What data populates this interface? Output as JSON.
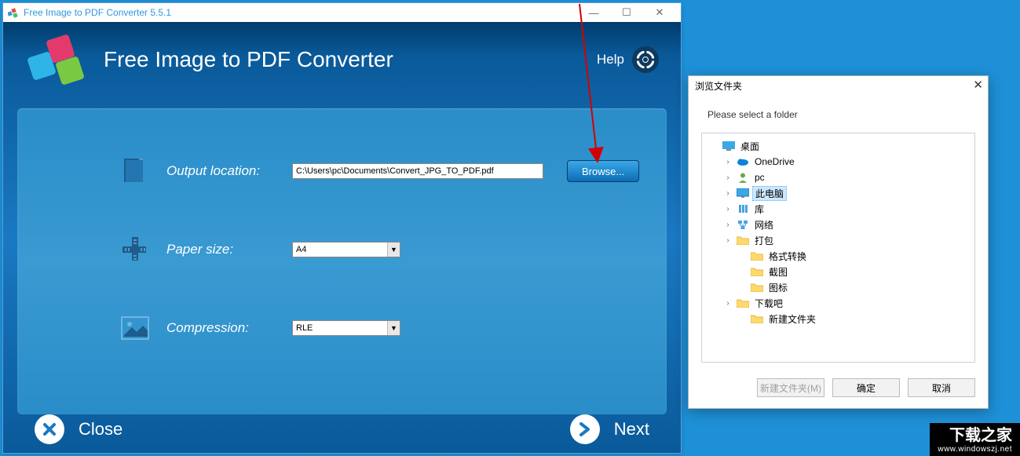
{
  "titlebar": {
    "title": "Free Image to PDF Converter 5.5.1"
  },
  "header": {
    "app_title": "Free Image to PDF Converter",
    "help_label": "Help"
  },
  "form": {
    "output_label": "Output location:",
    "output_value": "C:\\Users\\pc\\Documents\\Convert_JPG_TO_PDF.pdf",
    "browse_label": "Browse...",
    "paper_label": "Paper size:",
    "paper_value": "A4",
    "compression_label": "Compression:",
    "compression_value": "RLE"
  },
  "footer": {
    "close_label": "Close",
    "next_label": "Next"
  },
  "dialog": {
    "title": "浏览文件夹",
    "prompt": "Please select a folder",
    "tree": [
      {
        "indent": 0,
        "exp": "",
        "icon": "desktop",
        "label": "桌面",
        "selected": false
      },
      {
        "indent": 1,
        "exp": "›",
        "icon": "onedrive",
        "label": "OneDrive",
        "selected": false
      },
      {
        "indent": 1,
        "exp": "›",
        "icon": "user",
        "label": "pc",
        "selected": false
      },
      {
        "indent": 1,
        "exp": "›",
        "icon": "pc",
        "label": "此电脑",
        "selected": true
      },
      {
        "indent": 1,
        "exp": "›",
        "icon": "lib",
        "label": "库",
        "selected": false
      },
      {
        "indent": 1,
        "exp": "›",
        "icon": "net",
        "label": "网络",
        "selected": false
      },
      {
        "indent": 1,
        "exp": "›",
        "icon": "folder",
        "label": "打包",
        "selected": false
      },
      {
        "indent": 2,
        "exp": "",
        "icon": "folder",
        "label": "格式转换",
        "selected": false
      },
      {
        "indent": 2,
        "exp": "",
        "icon": "folder",
        "label": "截图",
        "selected": false
      },
      {
        "indent": 2,
        "exp": "",
        "icon": "folder",
        "label": "图标",
        "selected": false
      },
      {
        "indent": 1,
        "exp": "›",
        "icon": "folder",
        "label": "下载吧",
        "selected": false
      },
      {
        "indent": 2,
        "exp": "",
        "icon": "folder",
        "label": "新建文件夹",
        "selected": false
      }
    ],
    "new_folder_btn": "新建文件夹(M)",
    "ok_btn": "确定",
    "cancel_btn": "取消"
  },
  "watermark": {
    "brand": "下载之家",
    "url": "www.windowszj.net"
  }
}
